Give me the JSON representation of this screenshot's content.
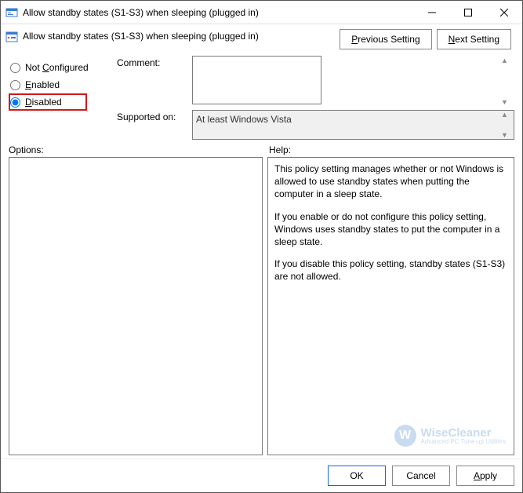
{
  "window": {
    "title": "Allow standby states (S1-S3) when sleeping (plugged in)"
  },
  "header": {
    "setting_title": "Allow standby states (S1-S3) when sleeping (plugged in)",
    "prev_p": "P",
    "prev_rest": "revious Setting",
    "next_n": "N",
    "next_rest": "ext Setting"
  },
  "radios": {
    "not_configured_c": "C",
    "not_configured_rest": "onfigured",
    "not_prefix": "Not ",
    "enabled_e": "E",
    "enabled_rest": "nabled",
    "disabled_d": "D",
    "disabled_rest": "isabled"
  },
  "fields": {
    "comment_label": "Comment:",
    "supported_label": "Supported on:",
    "supported_value": "At least Windows Vista"
  },
  "panels": {
    "options_label": "Options:",
    "help_label": "Help:"
  },
  "help": {
    "p1": "This policy setting manages whether or not Windows is allowed to use standby states when putting the computer in a sleep state.",
    "p2": "If you enable or do not configure this policy setting, Windows uses standby states to put the computer in a sleep state.",
    "p3": "If you disable this policy setting, standby states (S1-S3) are not allowed."
  },
  "buttons": {
    "ok": "OK",
    "cancel": "Cancel",
    "apply_a": "A",
    "apply_rest": "pply"
  },
  "watermark": {
    "glyph": "W",
    "brand": "WiseCleaner",
    "tagline": "Advanced PC Tune-up Utilities"
  }
}
